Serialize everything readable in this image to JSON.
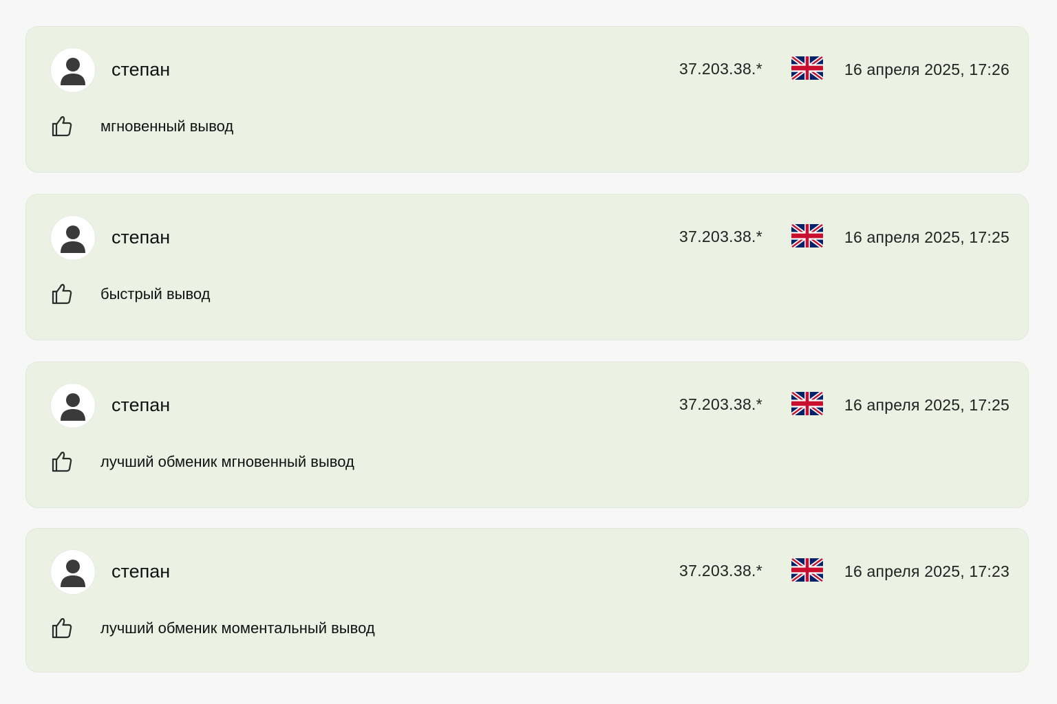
{
  "reviews": [
    {
      "author": "степан",
      "ip": "37.203.38.*",
      "flag": "uk-flag-icon",
      "date": "16 апреля 2025, 17:26",
      "text": "мгновенный вывод"
    },
    {
      "author": "степан",
      "ip": "37.203.38.*",
      "flag": "uk-flag-icon",
      "date": "16 апреля 2025, 17:25",
      "text": "быстрый вывод"
    },
    {
      "author": "степан",
      "ip": "37.203.38.*",
      "flag": "uk-flag-icon",
      "date": "16 апреля 2025, 17:25",
      "text": "лучший обменик мгновенный вывод"
    },
    {
      "author": "степан",
      "ip": "37.203.38.*",
      "flag": "uk-flag-icon",
      "date": "16 апреля 2025, 17:23",
      "text": "лучший обменик моментальный вывод"
    }
  ],
  "colors": {
    "page_background": "#f7f7f7",
    "card_background": "#ebf1e3",
    "card_border": "#dfe8d6",
    "avatar_figure": "#3a3a3a",
    "flag_blue": "#012169",
    "flag_red": "#c8102e"
  }
}
